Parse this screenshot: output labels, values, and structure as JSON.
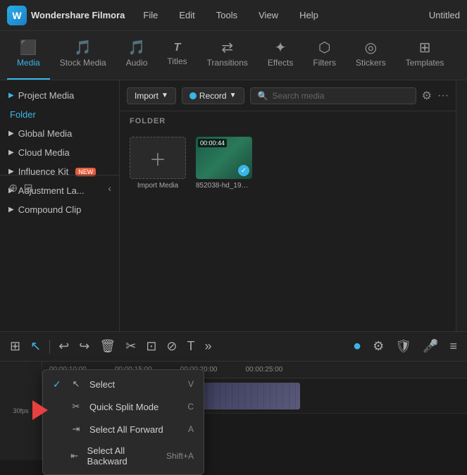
{
  "titlebar": {
    "logo_letter": "W",
    "app_name": "Wondershare Filmora",
    "menu_items": [
      "File",
      "Edit",
      "Tools",
      "View",
      "Help"
    ],
    "window_title": "Untitled"
  },
  "toolbar": {
    "items": [
      {
        "id": "media",
        "label": "Media",
        "icon": "🎬",
        "active": true
      },
      {
        "id": "stock_media",
        "label": "Stock Media",
        "icon": "🎵"
      },
      {
        "id": "audio",
        "label": "Audio",
        "icon": "♪"
      },
      {
        "id": "titles",
        "label": "Titles",
        "icon": "T"
      },
      {
        "id": "transitions",
        "label": "Transitions",
        "icon": "↔"
      },
      {
        "id": "effects",
        "label": "Effects",
        "icon": "✨"
      },
      {
        "id": "filters",
        "label": "Filters",
        "icon": "⬡"
      },
      {
        "id": "stickers",
        "label": "Stickers",
        "icon": "◎"
      },
      {
        "id": "templates",
        "label": "Templates",
        "icon": "⊞"
      }
    ]
  },
  "sidebar": {
    "sections": [
      {
        "id": "project_media",
        "label": "Project Media",
        "has_arrow": true
      },
      {
        "id": "folder",
        "label": "Folder",
        "color": "green"
      },
      {
        "id": "global_media",
        "label": "Global Media",
        "has_arrow": true
      },
      {
        "id": "cloud_media",
        "label": "Cloud Media",
        "has_arrow": true
      },
      {
        "id": "influence_kit",
        "label": "Influence Kit",
        "has_arrow": true,
        "badge": "NEW"
      },
      {
        "id": "adjustment_la",
        "label": "Adjustment La...",
        "has_arrow": true
      },
      {
        "id": "compound_clip",
        "label": "Compound Clip",
        "has_arrow": true
      }
    ],
    "bottom_icons": [
      "add_folder",
      "remove_folder"
    ],
    "collapse_icon": "‹"
  },
  "content": {
    "import_btn": "Import",
    "record_btn": "Record",
    "search_placeholder": "Search media",
    "folder_label": "FOLDER",
    "media_items": [
      {
        "type": "import",
        "label": "Import Media"
      },
      {
        "type": "video",
        "filename": "852038-hd_1920....",
        "duration": "00:00:44",
        "checked": true
      }
    ]
  },
  "timeline": {
    "toolbar_icons": [
      "grid",
      "cursor",
      "undo",
      "redo",
      "trash",
      "scissors",
      "crop",
      "split",
      "text",
      "more"
    ],
    "time_markers": [
      "00:00:10:00",
      "00:00:15:00",
      "00:00:20:00",
      "00:00:25:00"
    ],
    "right_icons": [
      "circle_green",
      "settings_circle",
      "shield",
      "mic",
      "list"
    ],
    "fps_label": "30fps"
  },
  "dropdown": {
    "items": [
      {
        "id": "select",
        "label": "Select",
        "shortcut": "V",
        "checked": true,
        "icon": "cursor"
      },
      {
        "id": "quick_split",
        "label": "Quick Split Mode",
        "shortcut": "C",
        "icon": "scissors"
      },
      {
        "id": "select_forward",
        "label": "Select All Forward",
        "shortcut": "A",
        "icon": "forward"
      },
      {
        "id": "select_backward",
        "label": "Select All Backward",
        "shortcut": "Shift+A",
        "icon": "backward"
      }
    ]
  }
}
